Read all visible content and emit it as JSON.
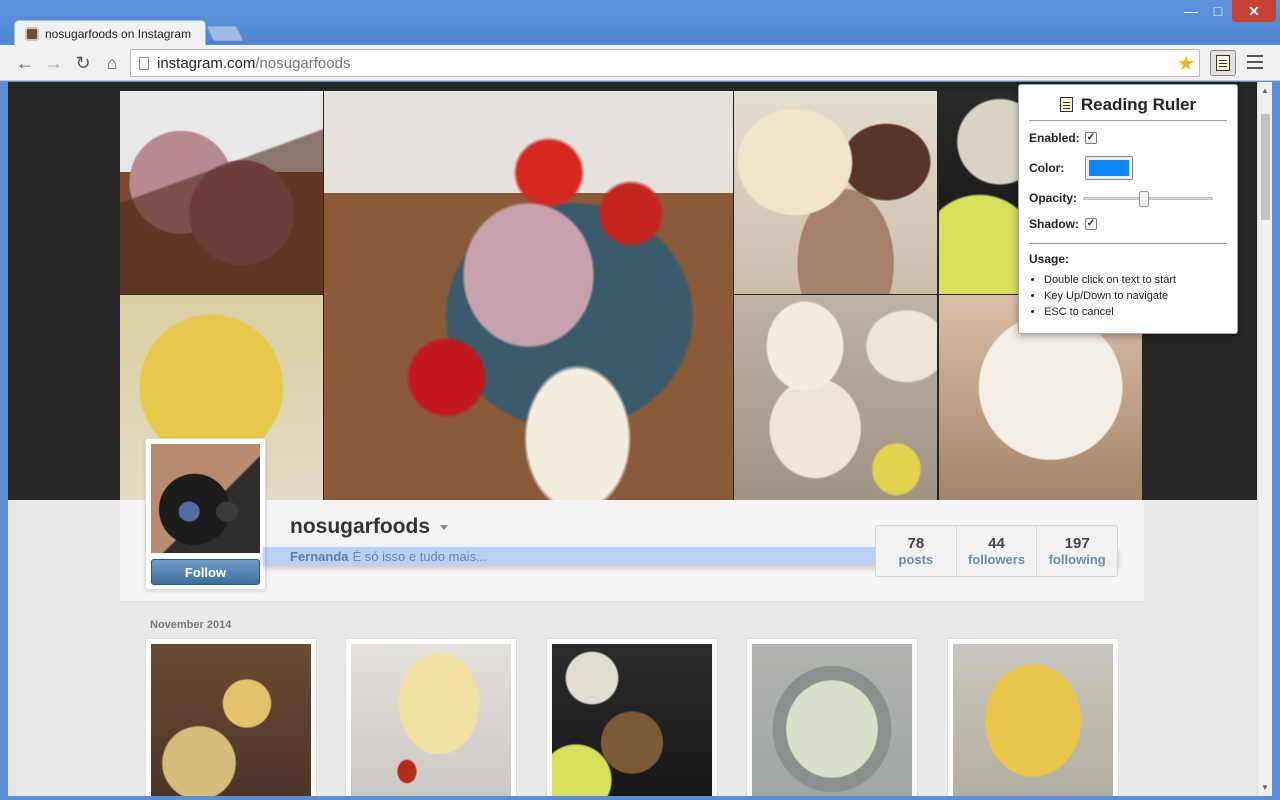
{
  "tab": {
    "title": "nosugarfoods on Instagram"
  },
  "address": {
    "host": "instagram.com",
    "path": "/nosugarfoods"
  },
  "profile": {
    "username": "nosugarfoods",
    "full_name": "Fernanda",
    "bio": "É só isso e tudo mais...",
    "follow_label": "Follow"
  },
  "stats": [
    {
      "value": "78",
      "label": "posts"
    },
    {
      "value": "44",
      "label": "followers"
    },
    {
      "value": "197",
      "label": "following"
    }
  ],
  "feed": {
    "month_label": "November 2014"
  },
  "reading_ruler": {
    "title": "Reading Ruler",
    "enabled_label": "Enabled:",
    "enabled": true,
    "color_label": "Color:",
    "color": "#0a84ff",
    "opacity_label": "Opacity:",
    "opacity": 0.47,
    "shadow_label": "Shadow:",
    "shadow": true,
    "usage_title": "Usage:",
    "usage": [
      "Double click on text to start",
      "Key Up/Down to navigate",
      "ESC to cancel"
    ]
  },
  "icons": {
    "back": "back-arrow-icon",
    "forward": "forward-arrow-icon",
    "reload": "reload-icon",
    "home": "home-icon",
    "bookmark": "star-icon",
    "extension": "reading-ruler-icon",
    "menu": "hamburger-menu-icon"
  }
}
